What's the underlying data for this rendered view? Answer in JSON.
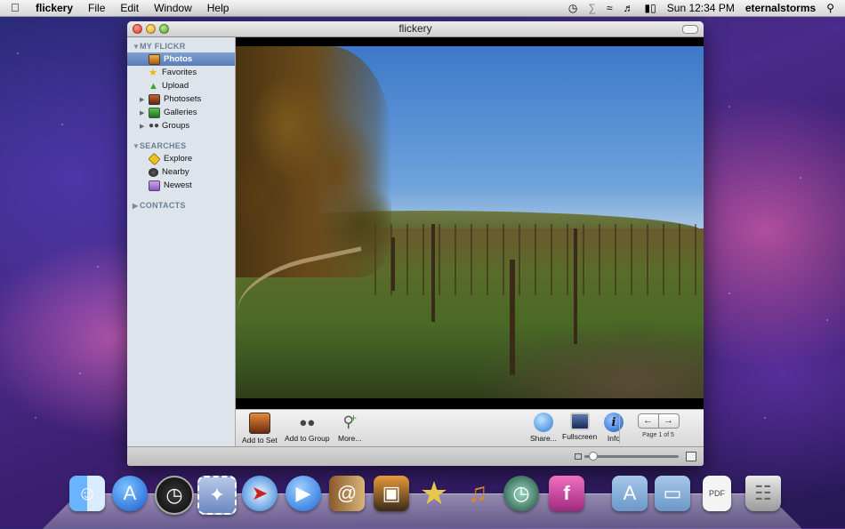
{
  "menubar": {
    "app_name": "flickery",
    "menus": [
      "File",
      "Edit",
      "Window",
      "Help"
    ],
    "clock": "Sun 12:34 PM",
    "user": "eternalstorms"
  },
  "window": {
    "title": "flickery"
  },
  "sidebar": {
    "my_flickr_header": "MY FLICKR",
    "my_flickr": [
      {
        "label": "Photos",
        "selected": true,
        "icon": "photo-icon"
      },
      {
        "label": "Favorites",
        "icon": "star-icon"
      },
      {
        "label": "Upload",
        "icon": "upload-arrow-icon"
      },
      {
        "label": "Photosets",
        "icon": "photoset-icon",
        "expandable": true
      },
      {
        "label": "Galleries",
        "icon": "gallery-icon",
        "expandable": true
      },
      {
        "label": "Groups",
        "icon": "group-icon",
        "expandable": true
      }
    ],
    "searches_header": "SEARCHES",
    "searches": [
      {
        "label": "Explore",
        "icon": "explore-icon"
      },
      {
        "label": "Nearby",
        "icon": "nearby-icon"
      },
      {
        "label": "Newest",
        "icon": "newest-icon"
      }
    ],
    "contacts_header": "CONTACTS"
  },
  "toolbar": {
    "add_to_set": "Add to Set",
    "add_to_group": "Add to Group",
    "more": "More...",
    "share": "Share...",
    "fullscreen": "Fullscreen",
    "info": "Info",
    "page_label": "Page 1 of 5"
  },
  "colors": {
    "selection": "#5a7cb8",
    "sidebar_bg": "#dde4ec"
  }
}
